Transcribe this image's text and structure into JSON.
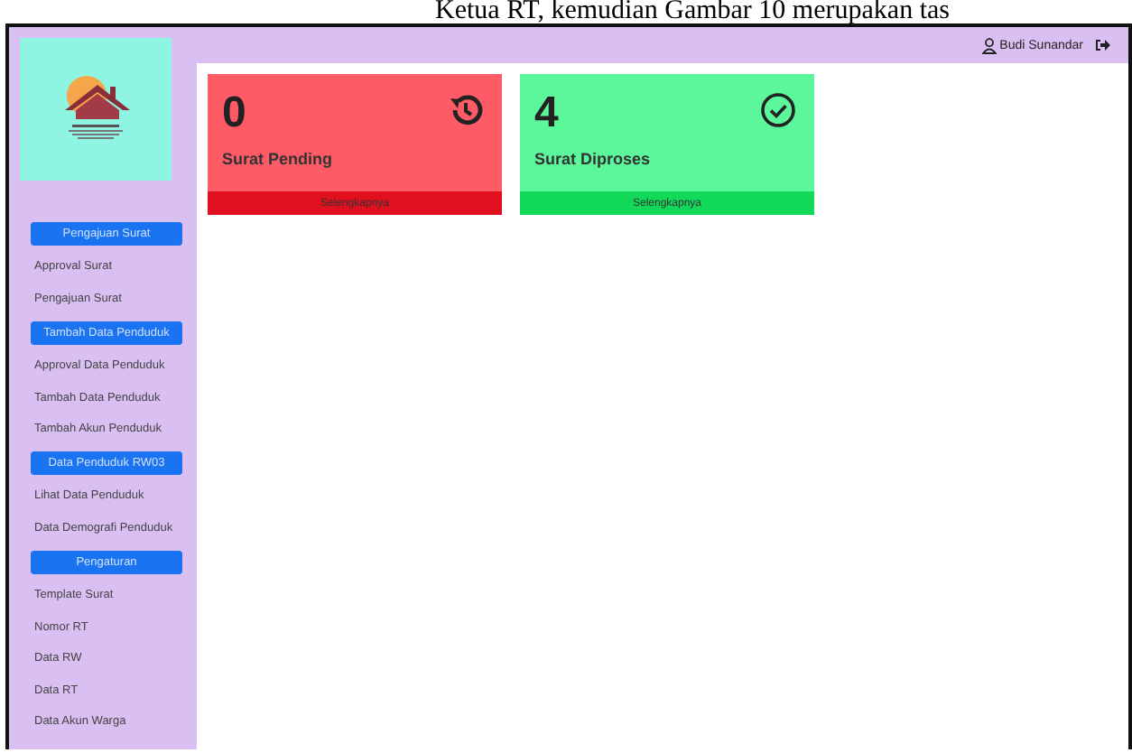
{
  "caption": "Ketua RT, kemudian Gambar 10 merupakan tas",
  "header": {
    "user": "Budi Sunandar"
  },
  "sidebar": {
    "sections": [
      {
        "title": "Pengajuan Surat",
        "items": [
          "Approval Surat",
          "Pengajuan Surat"
        ]
      },
      {
        "title": "Tambah Data Penduduk",
        "items": [
          "Approval Data Penduduk",
          "Tambah Data Penduduk",
          "Tambah Akun Penduduk"
        ]
      },
      {
        "title": "Data Penduduk RW03",
        "items": [
          "Lihat Data Penduduk",
          "Data Demografi Penduduk"
        ]
      },
      {
        "title": "Pengaturan",
        "items": [
          "Template Surat",
          "Nomor RT",
          "Data RW",
          "Data RT",
          "Data Akun Warga"
        ]
      }
    ]
  },
  "cards": [
    {
      "count": "0",
      "label": "Surat Pending",
      "link": "Selengkapnya",
      "kind": "pending",
      "color": "#ff5b66"
    },
    {
      "count": "4",
      "label": "Surat Diproses",
      "link": "Selengkapnya",
      "kind": "done",
      "color": "#5cf79a"
    }
  ]
}
